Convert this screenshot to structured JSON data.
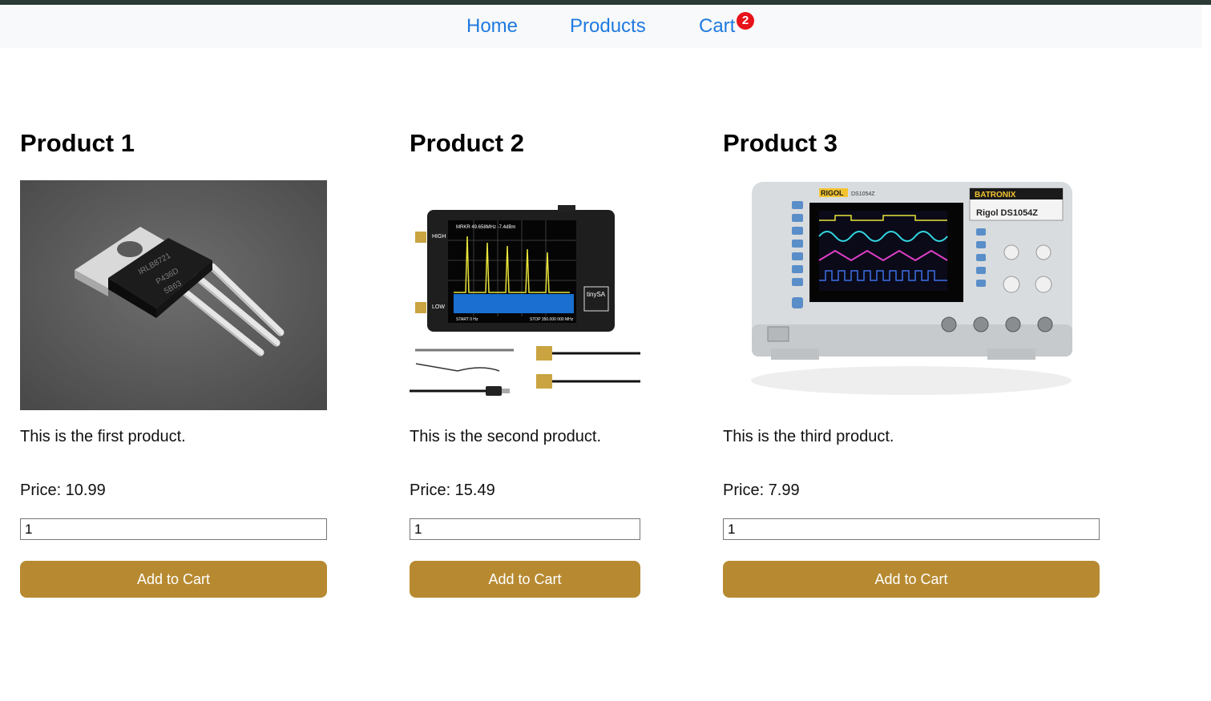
{
  "nav": {
    "home_label": "Home",
    "products_label": "Products",
    "cart_label": "Cart",
    "cart_count": "2"
  },
  "products": [
    {
      "title": "Product 1",
      "description": "This is the first product.",
      "price": "Price: 10.99",
      "quantity": "1",
      "button_label": "Add to Cart",
      "image_markings": [
        "IRLB8721",
        "P436D",
        "5B63"
      ]
    },
    {
      "title": "Product 2",
      "description": "This is the second product.",
      "price": "Price: 15.49",
      "quantity": "1",
      "button_label": "Add to Cart",
      "image_markings": [
        "tinySA",
        "HIGH",
        "LOW"
      ]
    },
    {
      "title": "Product 3",
      "description": "This is the third product.",
      "price": "Price: 7.99",
      "quantity": "1",
      "button_label": "Add to Cart",
      "image_markings": [
        "RIGOL",
        "DS1054Z",
        "BATRONIX",
        "Rigol DS1054Z"
      ]
    }
  ],
  "colors": {
    "accent_button": "#b78a31",
    "link": "#1f7ae0",
    "badge": "#e8121a",
    "navbar_bg": "#f8f9fa"
  }
}
